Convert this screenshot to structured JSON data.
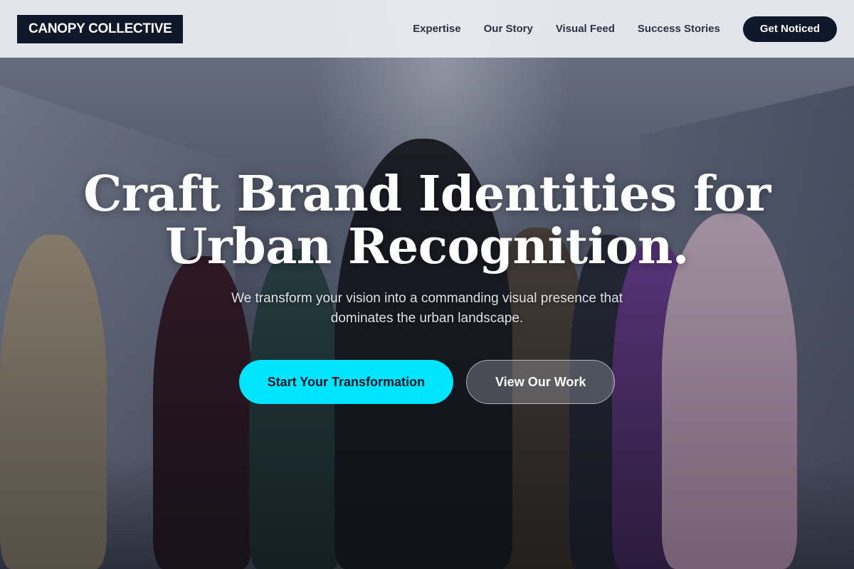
{
  "nav": {
    "logo": "CANOPY COLLECTIVE",
    "links": [
      {
        "label": "Expertise"
      },
      {
        "label": "Our Story"
      },
      {
        "label": "Visual Feed"
      },
      {
        "label": "Success Stories"
      }
    ],
    "cta_label": "Get Noticed"
  },
  "hero": {
    "title_line1": "Craft Brand Identities for",
    "title_line2": "Urban Recognition.",
    "subtitle": "We transform your vision into a commanding visual presence that dominates the urban landscape.",
    "primary_button": "Start Your Transformation",
    "secondary_button": "View Our Work"
  },
  "colors": {
    "brand_dark": "#0f172a",
    "accent_cyan": "#00e5ff",
    "nav_background": "#eceef2"
  }
}
